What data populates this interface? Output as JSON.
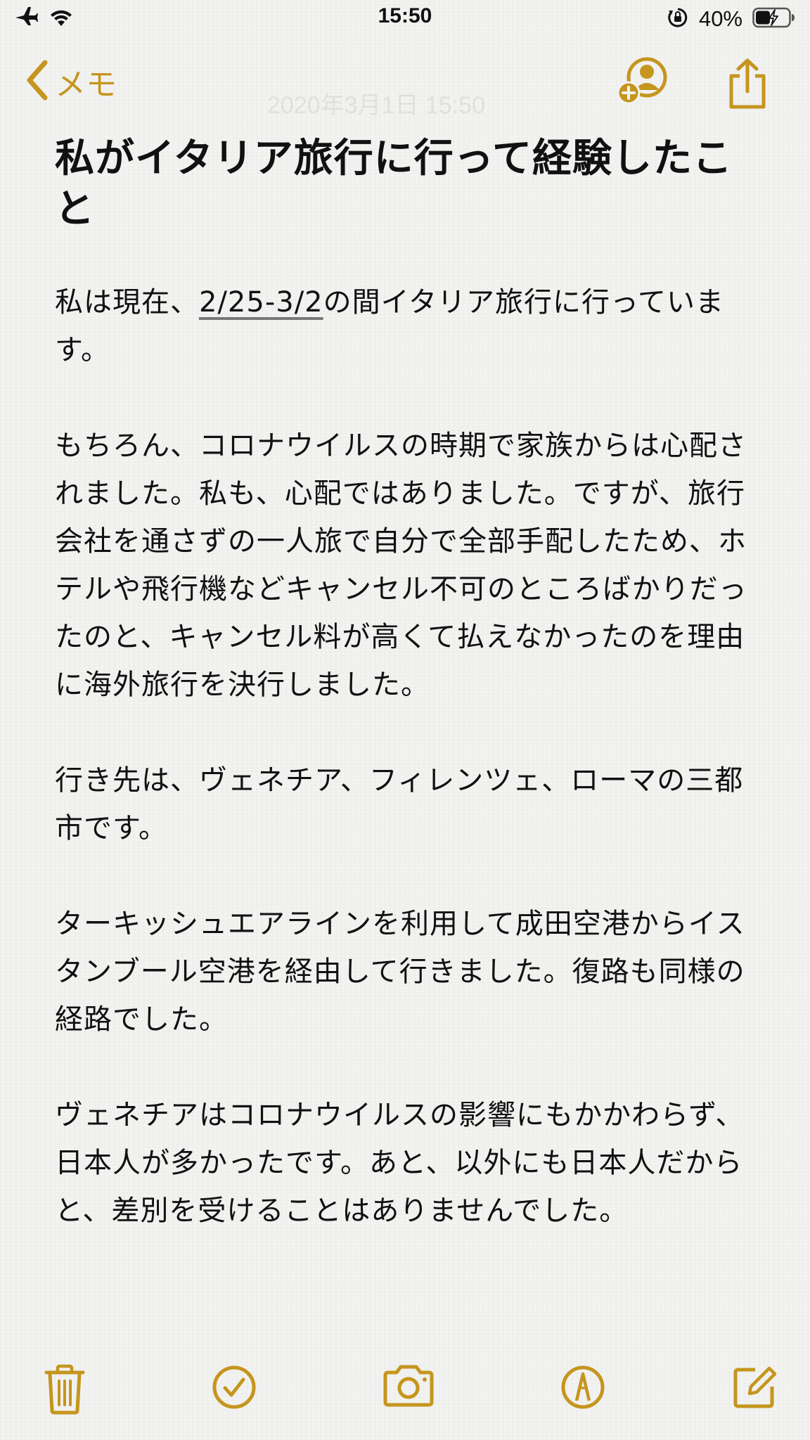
{
  "status_bar": {
    "time": "15:50",
    "battery_percent": "40%",
    "icons": [
      "airplane-icon",
      "wifi-icon",
      "orientation-lock-icon",
      "battery-charging-icon"
    ]
  },
  "nav": {
    "back_label": "メモ",
    "faded_date": "2020年3月1日 15:50",
    "actions": [
      "add-person-icon",
      "share-icon"
    ]
  },
  "note": {
    "title": "私がイタリア旅行に行って経験したこと",
    "paragraph1_prefix": "私は現在、",
    "paragraph1_link": "2/25-3/2",
    "paragraph1_suffix": "の間イタリア旅行に行っています。",
    "paragraph2": "もちろん、コロナウイルスの時期で家族からは心配されました。私も、心配ではありました。ですが、旅行会社を通さずの一人旅で自分で全部手配したため、ホテルや飛行機などキャンセル不可のところばかりだったのと、キャンセル料が高くて払えなかったのを理由に海外旅行を決行しました。",
    "paragraph3": "行き先は、ヴェネチア、フィレンツェ、ローマの三都市です。",
    "paragraph4": "ターキッシュエアラインを利用して成田空港からイスタンブール空港を経由して行きました。復路も同様の経路でした。",
    "paragraph5": "ヴェネチアはコロナウイルスの影響にもかかわらず、日本人が多かったです。あと、以外にも日本人だからと、差別を受けることはありませんでした。"
  },
  "toolbar": {
    "items": [
      "trash-icon",
      "checklist-icon",
      "camera-icon",
      "markup-icon",
      "compose-icon"
    ]
  },
  "colors": {
    "accent": "#c5951e",
    "text": "#111111",
    "background": "#f3f3f1"
  }
}
